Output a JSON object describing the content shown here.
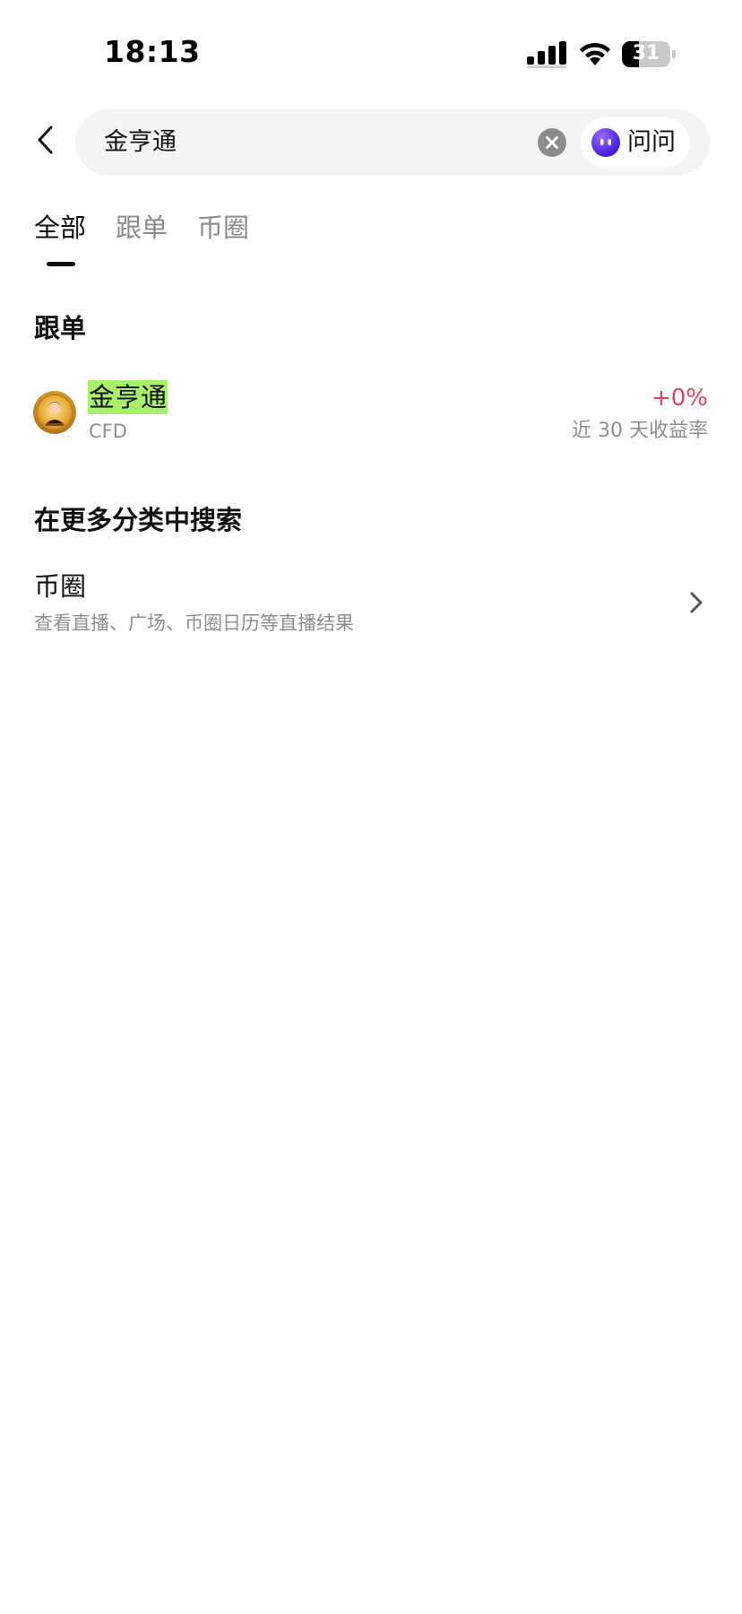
{
  "status_bar": {
    "time": "18:13",
    "battery": "31",
    "icons": [
      "signal-icon",
      "wifi-icon",
      "battery-icon"
    ]
  },
  "search": {
    "query": "金亨通",
    "ask_label": "问问",
    "icons": [
      "back-arrow-icon",
      "clear-icon",
      "assistant-icon"
    ]
  },
  "tabs": [
    {
      "label": "全部",
      "active": true
    },
    {
      "label": "跟单",
      "active": false
    },
    {
      "label": "币圈",
      "active": false
    }
  ],
  "copy_section": {
    "title": "跟单",
    "trader": {
      "name": "金亨通",
      "type": "CFD",
      "return_value": "+0%",
      "return_label": "近 30 天收益率"
    }
  },
  "more_section": {
    "title": "在更多分类中搜索",
    "categories": [
      {
        "title": "币圈",
        "description": "查看直播、广场、币圈日历等直播结果"
      }
    ]
  },
  "colors": {
    "highlight": "#a8f06a",
    "positive_return": "#e0445d",
    "muted_text": "#8e8e8e",
    "search_bg": "#f3f4f6",
    "assistant_icon": "#5b2cf0"
  }
}
